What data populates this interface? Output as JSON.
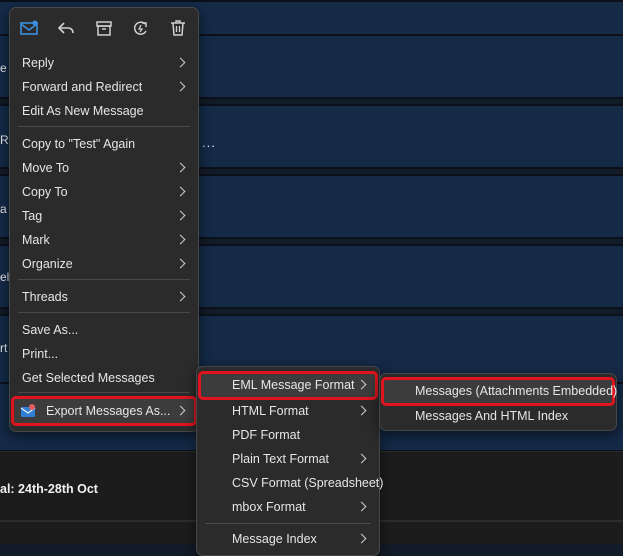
{
  "background": {
    "fragments": [
      "e",
      "Ra",
      "a",
      "el",
      "rt"
    ],
    "ellipsis": "...",
    "bottom_text": "al: 24th-28th Oct"
  },
  "toolbar": {
    "icons": [
      "new-message-icon",
      "reply-icon",
      "archive-icon",
      "refresh-icon",
      "trash-icon"
    ]
  },
  "main_menu": {
    "reply": "Reply",
    "forward_redirect": "Forward and Redirect",
    "edit_as_new": "Edit As New Message",
    "copy_again": "Copy to \"Test\" Again",
    "move_to": "Move To",
    "copy_to": "Copy To",
    "tag": "Tag",
    "mark": "Mark",
    "organize": "Organize",
    "threads": "Threads",
    "save_as": "Save As...",
    "print": "Print...",
    "get_selected": "Get Selected Messages",
    "export": "Export Messages As..."
  },
  "export_menu": {
    "eml": "EML Message Format",
    "html": "HTML Format",
    "pdf": "PDF Format",
    "plain_text": "Plain Text Format",
    "csv": "CSV Format (Spreadsheet)",
    "mbox": "mbox Format",
    "index": "Message Index"
  },
  "eml_menu": {
    "attachments_embedded": "Messages (Attachments Embedded)",
    "html_index": "Messages And HTML Index"
  },
  "colors": {
    "menu_bg": "#2b2b2b",
    "highlight": "#3c3c3c",
    "red_outline": "#e0141e",
    "accent_blue": "#3b8fe0"
  }
}
